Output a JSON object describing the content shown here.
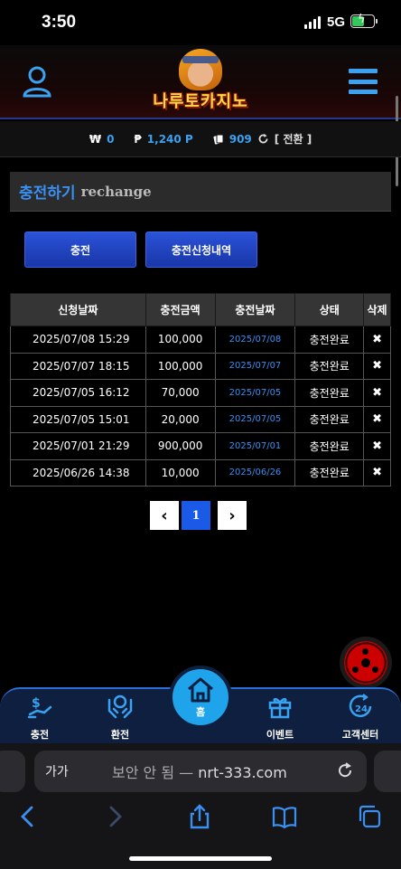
{
  "status_bar": {
    "time": "3:50",
    "network": "5G"
  },
  "header": {
    "logo_text": "나루토카지노"
  },
  "balance": {
    "won_symbol": "₩",
    "won_value": "0",
    "point_symbol": "₱",
    "point_value": "1,240 P",
    "card_value": "909",
    "switch_label": "[ 전환 ]"
  },
  "page_title": {
    "korean": "충전하기",
    "english": "rechange"
  },
  "tabs": [
    {
      "label": "충전"
    },
    {
      "label": "충전신청내역"
    }
  ],
  "table": {
    "headers": [
      "신청날짜",
      "충전금액",
      "충전날짜",
      "상태",
      "삭제"
    ],
    "rows": [
      {
        "request_date": "2025/07/08 15:29",
        "amount": "100,000",
        "charge_date": "2025/07/08",
        "status": "충전완료",
        "delete": "✖"
      },
      {
        "request_date": "2025/07/07 18:15",
        "amount": "100,000",
        "charge_date": "2025/07/07",
        "status": "충전완료",
        "delete": "✖"
      },
      {
        "request_date": "2025/07/05 16:12",
        "amount": "70,000",
        "charge_date": "2025/07/05",
        "status": "충전완료",
        "delete": "✖"
      },
      {
        "request_date": "2025/07/05 15:01",
        "amount": "20,000",
        "charge_date": "2025/07/05",
        "status": "충전완료",
        "delete": "✖"
      },
      {
        "request_date": "2025/07/01 21:29",
        "amount": "900,000",
        "charge_date": "2025/07/01",
        "status": "충전완료",
        "delete": "✖"
      },
      {
        "request_date": "2025/06/26 14:38",
        "amount": "10,000",
        "charge_date": "2025/06/26",
        "status": "충전완료",
        "delete": "✖"
      }
    ]
  },
  "pagination": {
    "prev": "‹",
    "current": "1",
    "next": "›"
  },
  "bottom_nav": {
    "charge": "충전",
    "exchange": "환전",
    "home": "홈",
    "event": "이벤트",
    "support": "고객센터"
  },
  "safari": {
    "aa_label": "가가",
    "insecure_label": "보안 안 됨 —",
    "domain": "nrt-333.com"
  },
  "colors": {
    "accent": "#3a8ff2",
    "tab_blue": "#1a36a8",
    "nav_bg": "#0e1f3f",
    "home_button": "#1fa3ea",
    "battery": "#34c759"
  }
}
